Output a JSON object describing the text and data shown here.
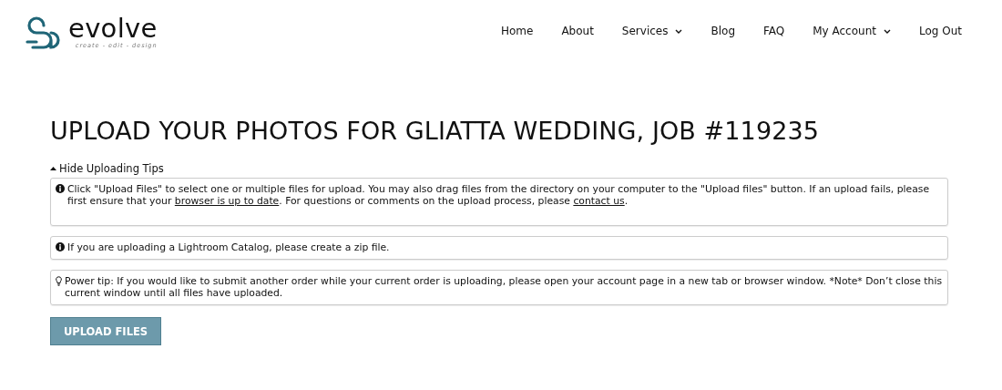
{
  "logo": {
    "name": "evolve",
    "tagline": "create - edit - design"
  },
  "nav": [
    {
      "label": "Home",
      "dropdown": false
    },
    {
      "label": "About",
      "dropdown": false
    },
    {
      "label": "Services",
      "dropdown": true
    },
    {
      "label": "Blog",
      "dropdown": false
    },
    {
      "label": "FAQ",
      "dropdown": false
    },
    {
      "label": "My Account",
      "dropdown": true
    },
    {
      "label": "Log Out",
      "dropdown": false
    }
  ],
  "title": "UPLOAD YOUR PHOTOS FOR GLIATTA WEDDING, JOB #119235",
  "tips_toggle": {
    "label": "Hide Uploading Tips",
    "expanded": true
  },
  "tips": [
    {
      "kind": "info",
      "parts": [
        {
          "kind": "text",
          "text": "Click \"Upload Files\" to select one or multiple files for upload. You may also drag files from the directory on your computer to the \"Upload files\" button. If an upload fails, please first ensure that your "
        },
        {
          "kind": "link",
          "text": "browser is up to date"
        },
        {
          "kind": "text",
          "text": ". For questions or comments on the upload process, please "
        },
        {
          "kind": "link",
          "text": "contact us"
        },
        {
          "kind": "text",
          "text": "."
        }
      ]
    },
    {
      "kind": "info",
      "parts": [
        {
          "kind": "text",
          "text": "If you are uploading a Lightroom Catalog, please create a zip file."
        }
      ]
    },
    {
      "kind": "bulb",
      "parts": [
        {
          "kind": "text",
          "text": "Power tip: If you would like to submit another order while your current order is uploading, please open your account page in a new tab or browser window. *Note* Don’t close this current window until all files have uploaded."
        }
      ]
    }
  ],
  "upload_button": "UPLOAD FILES"
}
